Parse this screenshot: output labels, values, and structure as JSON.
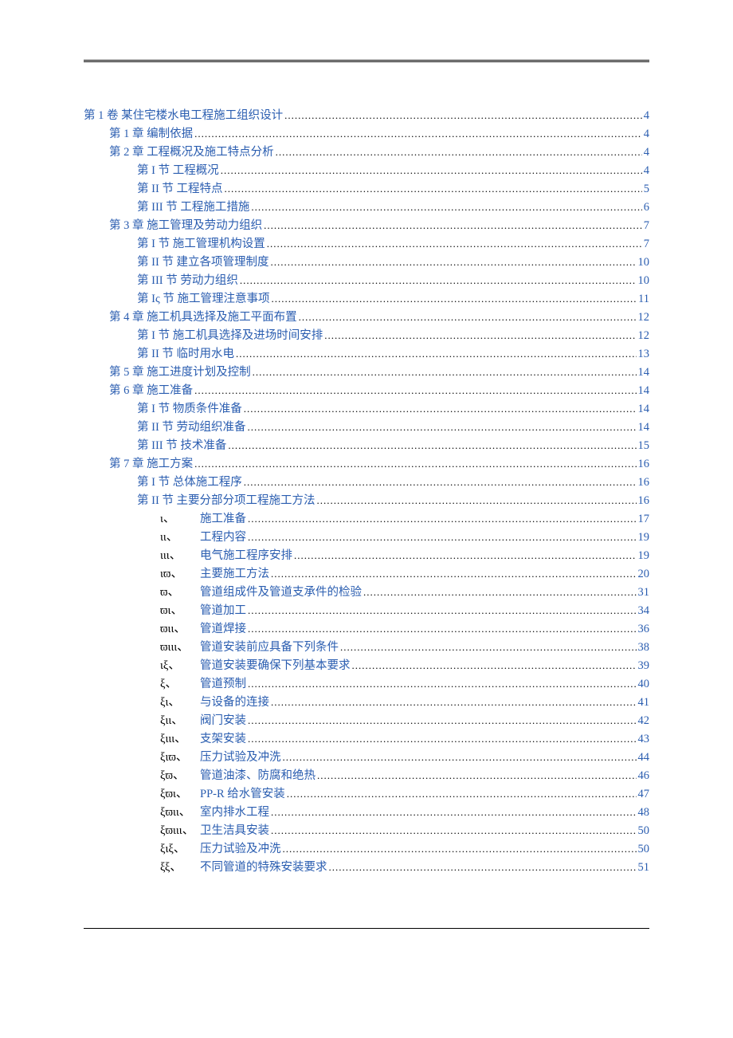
{
  "toc": [
    {
      "level": 0,
      "label": "第 1 卷  某住宅楼水电工程施工组织设计",
      "page": "4"
    },
    {
      "level": 1,
      "label": "第 1 章  编制依据",
      "page": "4"
    },
    {
      "level": 1,
      "label": "第 2 章  工程概况及施工特点分析",
      "page": "4"
    },
    {
      "level": 2,
      "label": "第 I 节  工程概况",
      "page": "4"
    },
    {
      "level": 2,
      "label": "第 II 节  工程特点",
      "page": "5"
    },
    {
      "level": 2,
      "label": "第 III 节  工程施工措施",
      "page": "6"
    },
    {
      "level": 1,
      "label": "第 3 章  施工管理及劳动力组织",
      "page": "7"
    },
    {
      "level": 2,
      "label": "第 I 节  施工管理机构设置",
      "page": "7"
    },
    {
      "level": 2,
      "label": "第 II 节  建立各项管理制度",
      "page": "10"
    },
    {
      "level": 2,
      "label": "第 III 节  劳动力组织",
      "page": "10"
    },
    {
      "level": 2,
      "label": "第 Iς 节  施工管理注意事项",
      "page": "11"
    },
    {
      "level": 1,
      "label": "第 4 章  施工机具选择及施工平面布置",
      "page": "12"
    },
    {
      "level": 2,
      "label": "第 I 节  施工机具选择及进场时间安排",
      "page": "12"
    },
    {
      "level": 2,
      "label": "第 II 节  临时用水电",
      "page": "13"
    },
    {
      "level": 1,
      "label": "第 5 章  施工进度计划及控制",
      "page": "14"
    },
    {
      "level": 1,
      "label": "第 6 章  施工准备",
      "page": "14"
    },
    {
      "level": 2,
      "label": "第 I 节  物质条件准备",
      "page": "14"
    },
    {
      "level": 2,
      "label": "第 II 节  劳动组织准备",
      "page": "14"
    },
    {
      "level": 2,
      "label": "第 III 节  技术准备",
      "page": "15"
    },
    {
      "level": 1,
      "label": "第 7 章  施工方案",
      "page": "16"
    },
    {
      "level": 2,
      "label": "第 I 节  总体施工程序",
      "page": "16"
    },
    {
      "level": 2,
      "label": "第 II 节  主要分部分项工程施工方法",
      "page": "16"
    },
    {
      "level": 3,
      "marker": "ι、",
      "label": "施工准备",
      "page": "17"
    },
    {
      "level": 3,
      "marker": "ιι、",
      "label": "工程内容",
      "page": "19"
    },
    {
      "level": 3,
      "marker": "ιιι、",
      "label": "电气施工程序安排",
      "page": "19"
    },
    {
      "level": 3,
      "marker": "ιϖ、",
      "label": "主要施工方法",
      "page": "20"
    },
    {
      "level": 3,
      "marker": "ϖ、",
      "label": "管道组成件及管道支承件的检验",
      "page": "31"
    },
    {
      "level": 3,
      "marker": "ϖι、",
      "label": "管道加工",
      "page": "34"
    },
    {
      "level": 3,
      "marker": "ϖιι、",
      "label": "管道焊接",
      "page": "36"
    },
    {
      "level": 3,
      "marker": "ϖιιι、",
      "label": "管道安装前应具备下列条件",
      "page": "38"
    },
    {
      "level": 3,
      "marker": "ιξ、",
      "label": "管道安装要确保下列基本要求",
      "page": "39"
    },
    {
      "level": 3,
      "marker": "ξ、",
      "label": "管道预制",
      "page": "40"
    },
    {
      "level": 3,
      "marker": "ξι、",
      "label": "与设备的连接",
      "page": "41"
    },
    {
      "level": 3,
      "marker": "ξιι、",
      "label": "阀门安装",
      "page": "42"
    },
    {
      "level": 3,
      "marker": "ξιιι、",
      "label": "支架安装",
      "page": "43"
    },
    {
      "level": 3,
      "marker": "ξιϖ、",
      "label": "压力试验及冲洗",
      "page": "44"
    },
    {
      "level": 3,
      "marker": "ξϖ、",
      "label": "管道油漆、防腐和绝热",
      "page": "46"
    },
    {
      "level": 3,
      "marker": "ξϖι、",
      "label": "PP-R 给水管安装",
      "page": "47"
    },
    {
      "level": 3,
      "marker": "ξϖιι、",
      "label": "室内排水工程",
      "page": "48"
    },
    {
      "level": 3,
      "marker": "ξϖιιι、",
      "label": "卫生洁具安装",
      "page": "50"
    },
    {
      "level": 3,
      "marker": "ξιξ、",
      "label": "压力试验及冲洗",
      "page": "50"
    },
    {
      "level": 3,
      "marker": "ξξ、",
      "label": "不同管道的特殊安装要求",
      "page": "51"
    }
  ]
}
